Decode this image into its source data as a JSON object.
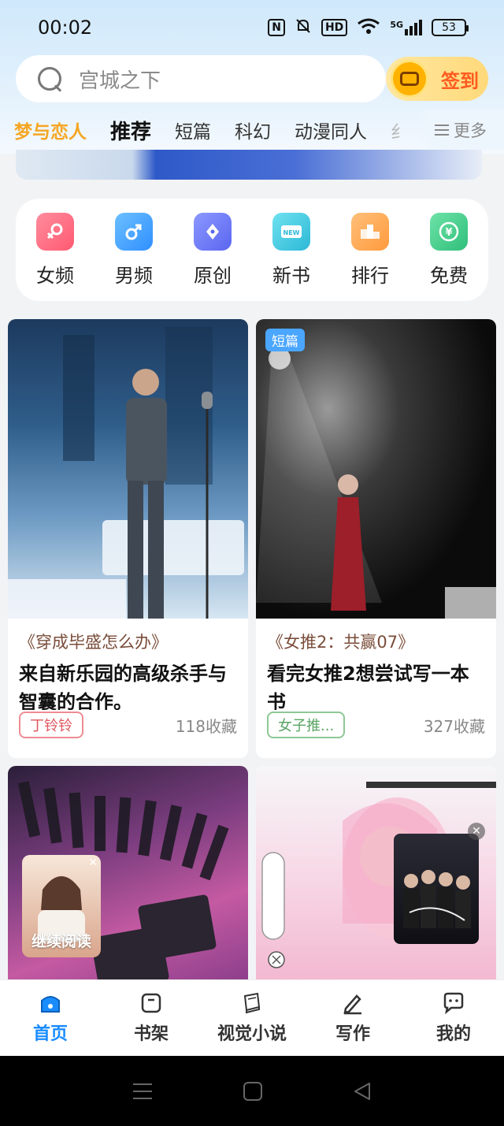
{
  "status_bar": {
    "time": "00:02",
    "nfc": "N",
    "hd": "HD",
    "network": "5G",
    "battery": "53"
  },
  "search": {
    "placeholder_text": "宫城之下",
    "signin_label": "签到"
  },
  "tabs": {
    "items": [
      "梦与恋人",
      "推荐",
      "短篇",
      "科幻",
      "动漫同人",
      "纟"
    ],
    "more_label": "更多"
  },
  "categories": [
    {
      "label": "女频",
      "color": "#ff6b81",
      "icon": "female-icon"
    },
    {
      "label": "男频",
      "color": "#3ba4ff",
      "icon": "male-icon"
    },
    {
      "label": "原创",
      "color": "#6b7bff",
      "icon": "pen-nib-icon"
    },
    {
      "label": "新书",
      "color": "#3cc8e0",
      "icon": "new-badge-icon"
    },
    {
      "label": "排行",
      "color": "#ffa64d",
      "icon": "podium-icon"
    },
    {
      "label": "免费",
      "color": "#3ecf8e",
      "icon": "yuan-coin-icon"
    }
  ],
  "cards": [
    {
      "subtitle": "《穿成毕盛怎么办》",
      "title": "来自新乐园的高级杀手与智囊的合作。",
      "tag": "丁铃铃",
      "favorites": "118收藏"
    },
    {
      "badge": "短篇",
      "subtitle": "《女推2：共赢07》",
      "title": "看完女推2想尝试写一本书",
      "tag": "女子推...",
      "favorites": "327收藏"
    }
  ],
  "continue_reading": {
    "label": "继续阅读"
  },
  "bottom_nav": [
    {
      "label": "首页",
      "icon": "home-icon",
      "active": true
    },
    {
      "label": "书架",
      "icon": "bookshelf-icon",
      "active": false
    },
    {
      "label": "视觉小说",
      "icon": "book-icon",
      "active": false
    },
    {
      "label": "写作",
      "icon": "pencil-icon",
      "active": false
    },
    {
      "label": "我的",
      "icon": "chat-bubble-icon",
      "active": false
    }
  ],
  "colors": {
    "accent": "#1a8cff",
    "brand_tab": "#f5a623",
    "signin": "#ff5a1f"
  }
}
